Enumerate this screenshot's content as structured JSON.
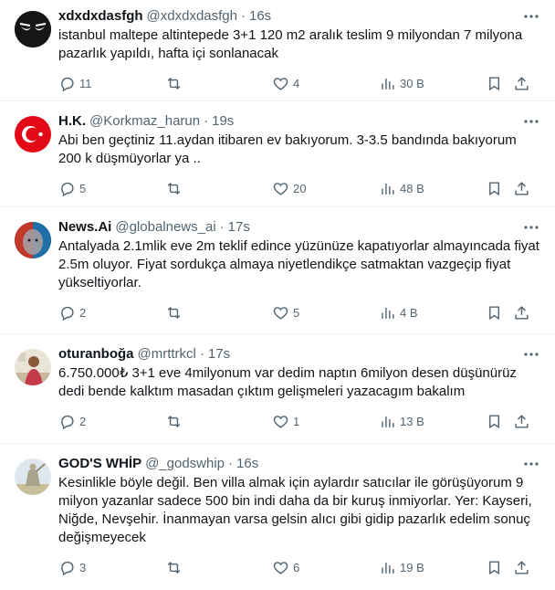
{
  "tweets": [
    {
      "name": "xdxdxdasfgh",
      "handle": "@xdxdxdasfgh",
      "sep": "·",
      "time": "16s",
      "text": "istanbul maltepe altintepede 3+1 120 m2 aralık teslim 9 milyondan 7 milyona pazarlık yapıldı, hafta içi sonlanacak",
      "replies": "11",
      "retweets": "",
      "likes": "4",
      "views": "30 B",
      "avatar": "dark-eyes-avatar"
    },
    {
      "name": "H.K.",
      "handle": "@Korkmaz_harun",
      "sep": "·",
      "time": "19s",
      "text": "Abi ben geçtiniz 11.aydan itibaren ev bakıyorum. 3-3.5 bandında bakıyorum 200 k düşmüyorlar ya ..",
      "replies": "5",
      "retweets": "",
      "likes": "20",
      "views": "48 B",
      "avatar": "turkish-flag-avatar"
    },
    {
      "name": "News.Ai",
      "handle": "@globalnews_ai",
      "sep": "·",
      "time": "17s",
      "text": "Antalyada 2.1mlik eve 2m teklif edince yüzünüze kapatıyorlar almayıncada fiyat 2.5m oluyor. Fiyat sordukça almaya niyetlendikçe satmaktan vazgeçip fiyat yükseltiyorlar.",
      "replies": "2",
      "retweets": "",
      "likes": "5",
      "views": "4 B",
      "avatar": "ai-face-avatar"
    },
    {
      "name": "oturanboğa",
      "handle": "@mrttrkcl",
      "sep": "·",
      "time": "17s",
      "text": "6.750.000₺ 3+1 eve 4milyonum var dedim naptın 6milyon desen düşünürüz dedi bende kalktım masadan çıktım gelişmeleri yazacagım bakalım",
      "replies": "2",
      "retweets": "",
      "likes": "1",
      "views": "13 B",
      "avatar": "person-photo-avatar"
    },
    {
      "name": "GOD'S WHİP",
      "handle": "@_godswhip",
      "sep": "·",
      "time": "16s",
      "text": "Kesinlikle böyle değil. Ben villa almak için aylardır satıcılar ile görüşüyorum 9 milyon yazanlar sadece 500 bin indi daha da bir kuruş inmiyorlar. Yer: Kayseri, Niğde, Nevşehir. İnanmayan varsa gelsin alıcı gibi gidip pazarlık edelim sonuç değişmeyecek",
      "replies": "3",
      "retweets": "",
      "likes": "6",
      "views": "19 B",
      "avatar": "statue-avatar"
    }
  ],
  "colors": {
    "secondary_text": "#536471",
    "primary_text": "#0f1419",
    "divider": "#eff3f4"
  }
}
